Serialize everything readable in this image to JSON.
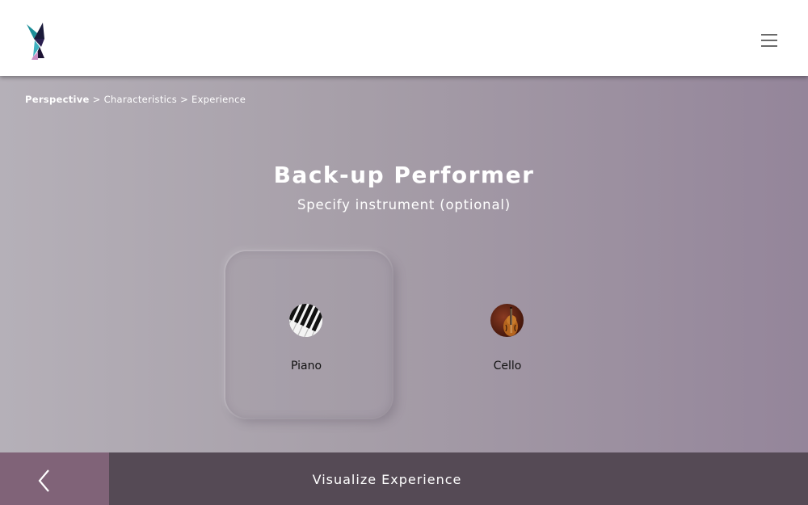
{
  "header": {
    "logo_icon": "brand-logo-icon",
    "menu_icon": "hamburger-menu-icon"
  },
  "breadcrumb": {
    "items": [
      "Perspective",
      "Characteristics",
      "Experience"
    ],
    "separator": ">"
  },
  "main": {
    "title": "Back-up Performer",
    "subtitle": "Specify instrument (optional)",
    "options": [
      {
        "label": "Piano",
        "icon": "piano-keys-icon",
        "selected": true
      },
      {
        "label": "Cello",
        "icon": "cello-icon",
        "selected": false
      }
    ]
  },
  "footer": {
    "back_icon": "chevron-left-icon",
    "cta_label": "Visualize Experience"
  },
  "colors": {
    "header_bg": "#ffffff",
    "back_button_bg": "#806378",
    "cta_bg": "#554a55",
    "text_light": "#ffffff"
  }
}
